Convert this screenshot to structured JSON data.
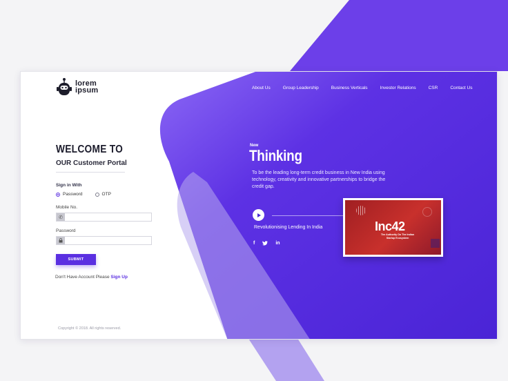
{
  "brand": {
    "line1": "lorem",
    "line2": "ipsum"
  },
  "nav": [
    "About Us",
    "Group Leadership",
    "Business Verticals",
    "Investor Relations",
    "CSR",
    "Contact Us"
  ],
  "login": {
    "title": "WELCOME TO",
    "subtitle": "OUR Customer Portal",
    "sign_in_label": "Sign in With",
    "options": [
      "Password",
      "OTP"
    ],
    "selected": "Password",
    "mobile_label": "Mobile No.",
    "password_label": "Password",
    "submit": "SUBMIT",
    "signup_prompt": "Don't Have Account Please",
    "signup_link": "Sign Up"
  },
  "hero": {
    "new_tag": "New",
    "title": "Thinking",
    "tagline": "To be the leading long-term credit business in New India using technology, creativity and innovative partnerships to bridge the credit gap.",
    "video_label": "Revolutionising Lending In India",
    "social": [
      "f",
      "t",
      "in"
    ],
    "video_thumb": {
      "logo": "Inc42",
      "caption": "The Authority On The Indian Startup Ecosystem"
    }
  },
  "footer": {
    "copyright": "Copyright © 2018. All rights reserved."
  },
  "colors": {
    "primary": "#5a2fe1",
    "deep": "#4a23d6",
    "light": "#8d6cf2"
  },
  "icons": {
    "phone": "phone-icon",
    "lock": "lock-icon",
    "play": "play-icon"
  }
}
